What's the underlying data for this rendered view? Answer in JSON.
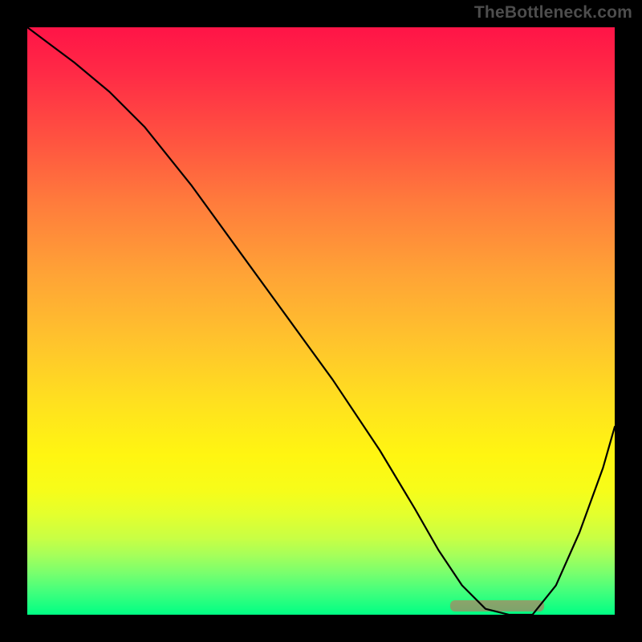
{
  "watermark": "TheBottleneck.com",
  "chart_data": {
    "type": "line",
    "title": "",
    "xlabel": "",
    "ylabel": "",
    "xlim": [
      0,
      100
    ],
    "ylim": [
      0,
      100
    ],
    "grid": false,
    "series": [
      {
        "name": "bottleneck-curve",
        "x": [
          0,
          4,
          8,
          14,
          20,
          28,
          36,
          44,
          52,
          60,
          66,
          70,
          74,
          78,
          82,
          86,
          90,
          94,
          98,
          100
        ],
        "y": [
          100,
          97,
          94,
          89,
          83,
          73,
          62,
          51,
          40,
          28,
          18,
          11,
          5,
          1,
          0,
          0,
          5,
          14,
          25,
          32
        ]
      }
    ],
    "minimum_band": {
      "x_start": 72,
      "x_end": 88,
      "y": 1.5
    },
    "background": {
      "type": "vertical-gradient",
      "stops": [
        {
          "pct": 0,
          "color": "#ff1447"
        },
        {
          "pct": 50,
          "color": "#ffc22d"
        },
        {
          "pct": 80,
          "color": "#f6fd1a"
        },
        {
          "pct": 100,
          "color": "#00ff84"
        }
      ]
    }
  }
}
